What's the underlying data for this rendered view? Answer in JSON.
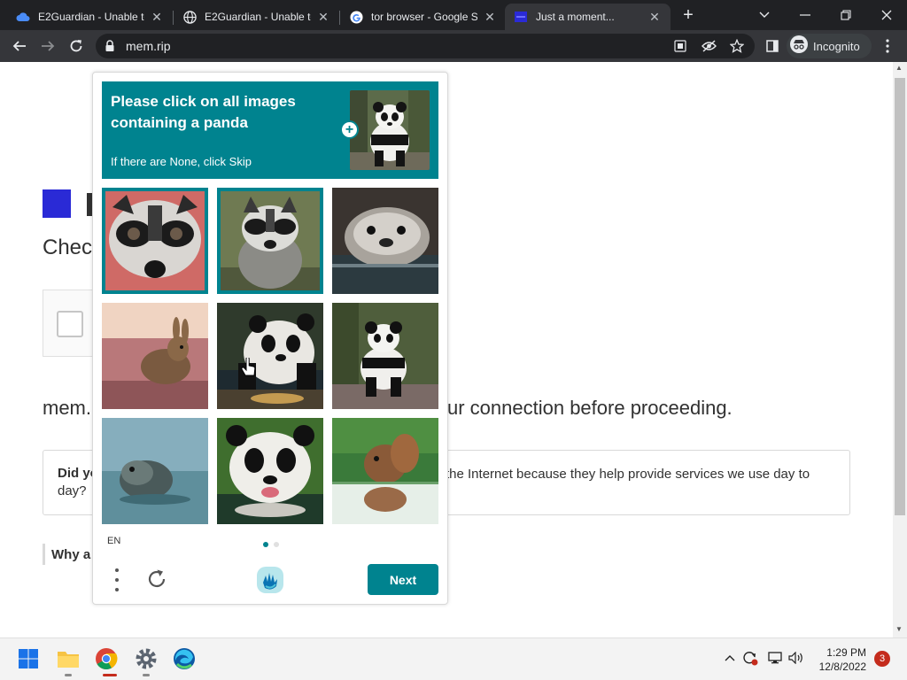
{
  "browser": {
    "tabs": [
      {
        "title": "E2Guardian - Unable to",
        "icon": "cloud-icon",
        "active": false
      },
      {
        "title": "E2Guardian - Unable to",
        "icon": "globe-icon",
        "active": false
      },
      {
        "title": "tor browser - Google S",
        "icon": "google-icon",
        "active": false
      },
      {
        "title": "Just a moment...",
        "icon": "site-favicon",
        "active": true
      }
    ],
    "new_tab": "+",
    "url": "mem.rip",
    "incognito_label": "Incognito"
  },
  "page": {
    "heading_fragment": "Check",
    "domain_fragment": "mem.",
    "connection_text": "ur connection before proceeding.",
    "did_you_fragment": "Did yo",
    "day_fragment": "day?",
    "internet_text": "the Internet because they help provide services we use day to",
    "why_fragment": "Why a"
  },
  "captcha": {
    "prompt_title": "Please click on all images containing a panda",
    "prompt_sub": "If there are None, click Skip",
    "example_label": "panda",
    "grid": [
      {
        "subject": "raccoon",
        "selected": true
      },
      {
        "subject": "raccoon",
        "selected": true
      },
      {
        "subject": "otter",
        "selected": false
      },
      {
        "subject": "rabbit",
        "selected": false
      },
      {
        "subject": "panda",
        "selected": false
      },
      {
        "subject": "panda",
        "selected": false
      },
      {
        "subject": "seal",
        "selected": false
      },
      {
        "subject": "panda",
        "selected": false
      },
      {
        "subject": "squirrel",
        "selected": false
      }
    ],
    "language": "EN",
    "next_label": "Next",
    "accent_color": "#00838f"
  },
  "taskbar": {
    "apps": [
      "windows-start-icon",
      "file-explorer-icon",
      "chrome-icon",
      "settings-icon",
      "edge-icon"
    ],
    "time": "1:29 PM",
    "date": "12/8/2022",
    "notification_count": "3"
  }
}
